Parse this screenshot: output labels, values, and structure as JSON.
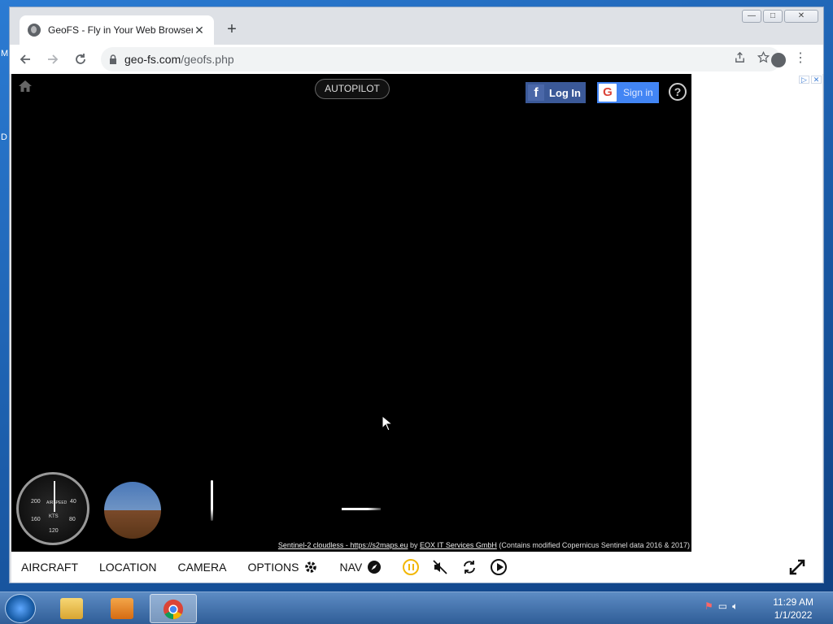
{
  "desktop": {
    "letters": [
      "M",
      "D"
    ]
  },
  "browser": {
    "tab": {
      "title": "GeoFS - Fly in Your Web Browser",
      "close": "✕"
    },
    "new_tab": "+",
    "window_controls": {
      "minimize": "—",
      "maximize": "□",
      "close": "✕"
    },
    "address": {
      "host": "geo-fs.com",
      "path": "/geofs.php"
    }
  },
  "game": {
    "autopilot_label": "AUTOPILOT",
    "facebook_login": "Log In",
    "google_signin": "Sign in",
    "help": "?",
    "airspeed": {
      "title": "AIRSPEED",
      "unit": "KTS",
      "ticks": [
        "200",
        "40",
        "160",
        "80",
        "120"
      ]
    },
    "attribution": {
      "part1": "Sentinel-2 cloudless - https://s2maps.eu",
      "by": " by ",
      "part2": "EOX IT Services GmbH",
      "part3": " (Contains modified Copernicus Sentinel data 2016 & 2017)"
    },
    "menu": {
      "aircraft": "AIRCRAFT",
      "location": "LOCATION",
      "camera": "CAMERA",
      "options": "OPTIONS",
      "nav": "NAV"
    }
  },
  "taskbar": {
    "clock_time": "11:29 AM",
    "clock_date": "1/1/2022"
  },
  "colors": {
    "pause_accent": "#f2b705",
    "facebook": "#3b5998",
    "google": "#4285f4"
  }
}
